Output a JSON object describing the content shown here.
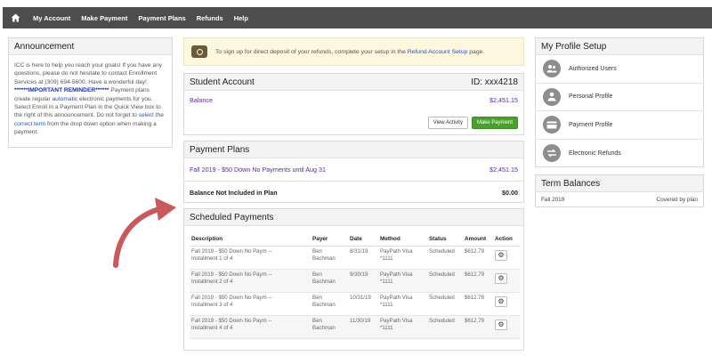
{
  "nav": {
    "home_icon": "home-icon",
    "items": [
      "My Account",
      "Make Payment",
      "Payment Plans",
      "Refunds",
      "Help"
    ]
  },
  "announcement": {
    "title": "Announcement",
    "p1": "ICC is here to help you reach your goals! If you have any questions, please do not hesitate to contact Enrollment Services at (309) 694-5600. Have a wonderful day!",
    "reminder": "******IMPORTANT REMINDER******",
    "p2a": " Payment plans create regular ",
    "p2_link": "automatic",
    "p2b": " electronic payments for you. Select Enroll in a Payment Plan in the Quick View box to the right of this announcement. Do not forget to ",
    "p2_link2": "select the correct term",
    "p2c": " from the drop down option when making a payment."
  },
  "banner": {
    "icon": "money-icon",
    "text_before": "To sign up for direct deposit of your refunds, complete your setup in the ",
    "link": "Refund Account Setup",
    "text_after": " page."
  },
  "student_account": {
    "title": "Student Account",
    "id": "ID: xxx4218",
    "balance_label": "Balance",
    "balance_value": "$2,451.15",
    "view_activity": "View Activity",
    "make_payment": "Make Payment"
  },
  "payment_plans": {
    "title": "Payment Plans",
    "plan_label": "Fall 2019 - $50 Down No Payments until Aug 31",
    "plan_value": "$2,451.15",
    "not_included_label": "Balance Not Included in Plan",
    "not_included_value": "$0.00"
  },
  "scheduled": {
    "title": "Scheduled Payments",
    "headers": [
      "Description",
      "Payer",
      "Date",
      "Method",
      "Status",
      "Amount",
      "Action"
    ],
    "rows": [
      {
        "desc1": "Fall 2019 - $50 Down No Paym --",
        "desc2": "Installment 1 of 4",
        "payer1": "Ben",
        "payer2": "Bachman",
        "date": "8/31/19",
        "method1": "PayPath Visa",
        "method2": "*1111",
        "status": "Scheduled",
        "amount": "$612.79"
      },
      {
        "desc1": "Fall 2019 - $50 Down No Paym --",
        "desc2": "Installment 2 of 4",
        "payer1": "Ben",
        "payer2": "Bachman",
        "date": "9/30/19",
        "method1": "PayPath Visa",
        "method2": "*1111",
        "status": "Scheduled",
        "amount": "$612.79"
      },
      {
        "desc1": "Fall 2019 - $50 Down No Paym --",
        "desc2": "Installment 3 of 4",
        "payer1": "Ben",
        "payer2": "Bachman",
        "date": "10/31/19",
        "method1": "PayPath Visa",
        "method2": "*1111",
        "status": "Scheduled",
        "amount": "$612.78"
      },
      {
        "desc1": "Fall 2019 - $50 Down No Paym --",
        "desc2": "Installment 4 of 4",
        "payer1": "Ben",
        "payer2": "Bachman",
        "date": "11/30/19",
        "method1": "PayPath Visa",
        "method2": "*1111",
        "status": "Scheduled",
        "amount": "$612.79"
      }
    ]
  },
  "profile": {
    "title": "My Profile Setup",
    "items": [
      {
        "label": "Authorized Users",
        "icon": "users-icon"
      },
      {
        "label": "Personal Profile",
        "icon": "person-icon"
      },
      {
        "label": "Payment Profile",
        "icon": "card-icon"
      },
      {
        "label": "Electronic Refunds",
        "icon": "refund-icon"
      }
    ]
  },
  "term_balances": {
    "title": "Term Balances",
    "term": "Fall 2019",
    "status": "Covered by plan"
  },
  "colors": {
    "navbar": "#4d4d4d",
    "link_purple": "#5c2d91",
    "button_green": "#4aa02c",
    "banner_bg": "#fdf7e0",
    "arrow": "#c9595b"
  }
}
